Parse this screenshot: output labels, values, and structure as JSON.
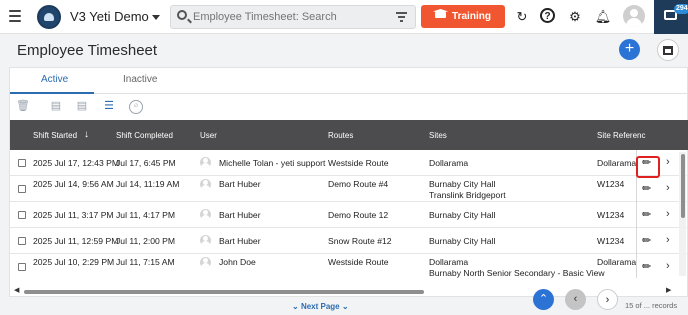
{
  "app": {
    "title": "V3 Yeti Demo"
  },
  "search": {
    "placeholder": "Employee Timesheet: Search"
  },
  "training": {
    "label": "Training"
  },
  "messages": {
    "badge": "294"
  },
  "page": {
    "title": "Employee Timesheet"
  },
  "tabs": [
    {
      "label": "Active",
      "selected": true
    },
    {
      "label": "Inactive",
      "selected": false
    }
  ],
  "table": {
    "columns": [
      "Shift Started",
      "Shift Completed",
      "User",
      "Routes",
      "Sites",
      "Site Referenc"
    ],
    "rows": [
      {
        "started": "2025 Jul 17, 12:43 PM",
        "completed": "Jul 17, 6:45 PM",
        "user": "Michelle Tolan - yeti support",
        "route": "Westside Route",
        "sites": [
          "Dollarama"
        ],
        "ref": "Dollarama"
      },
      {
        "started": "2025 Jul 14, 9:56 AM",
        "completed": "Jul 14, 11:19 AM",
        "user": "Bart Huber",
        "route": "Demo Route #4",
        "sites": [
          "Burnaby City Hall",
          "Translink Bridgeport"
        ],
        "ref": "W1234"
      },
      {
        "started": "2025 Jul 11, 3:17 PM",
        "completed": "Jul 11, 4:17 PM",
        "user": "Bart Huber",
        "route": "Demo Route 12",
        "sites": [
          "Burnaby City Hall"
        ],
        "ref": "W1234"
      },
      {
        "started": "2025 Jul 11, 12:59 PM",
        "completed": "Jul 11, 2:00 PM",
        "user": "Bart Huber",
        "route": "Snow Route #12",
        "sites": [
          "Burnaby City Hall"
        ],
        "ref": "W1234"
      },
      {
        "started": "2025 Jul 10, 2:29 PM",
        "completed": "Jul 11, 7:15 AM",
        "user": "John Doe",
        "route": "Westside Route",
        "sites": [
          "Dollarama",
          "Burnaby North Senior Secondary - Basic View"
        ],
        "ref": "Dollarama"
      }
    ]
  },
  "pagination": {
    "next_label": "Next Page",
    "records": "15 of ... records"
  },
  "colors": {
    "accent": "#2b74d6",
    "training": "#f0562f",
    "header": "#4c4c4e",
    "nav_dark": "#1e3b59",
    "highlight": "#e02020"
  }
}
